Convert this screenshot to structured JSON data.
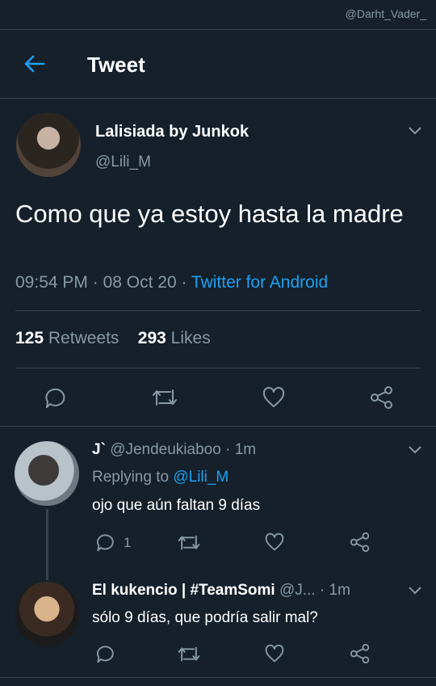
{
  "watermark": "@Darht_Vader_",
  "header": {
    "title": "Tweet"
  },
  "tweet": {
    "author_name": "Lalisiada by Junkok",
    "author_handle": "@Lili_M",
    "text": "Como que ya estoy hasta la madre",
    "time": "09:54 PM",
    "date": "08 Oct 20",
    "client": "Twitter for Android",
    "retweets": "125",
    "retweets_label": "Retweets",
    "likes": "293",
    "likes_label": "Likes"
  },
  "replies": [
    {
      "name": "J`",
      "handle": "@Jendeukiaboo",
      "time": "1m",
      "replying_label": "Replying to",
      "replying_to": "@Lili_M",
      "text": "ojo que aún faltan 9 días",
      "reply_count": "1"
    },
    {
      "name": "El kukencio | #TeamSomi",
      "handle": "@J...",
      "time": "1m",
      "text": "sólo 9 días, que podría salir mal?"
    }
  ],
  "colors": {
    "background": "#15202b",
    "accent": "#1da1f2",
    "muted": "#8899a6",
    "border": "#38444d"
  },
  "icons": [
    "back-arrow-icon",
    "chevron-down-icon",
    "reply-icon",
    "retweet-icon",
    "like-icon",
    "share-icon"
  ]
}
